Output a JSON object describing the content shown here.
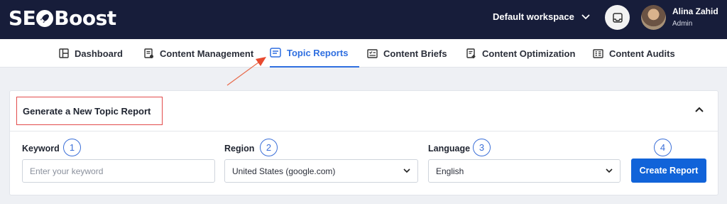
{
  "header": {
    "logo_prefix": "SE",
    "logo_suffix": "Boost",
    "workspace_label": "Default workspace",
    "user_name": "Alina Zahid",
    "user_role": "Admin"
  },
  "nav": {
    "items": [
      {
        "label": "Dashboard",
        "icon": "dashboard-icon"
      },
      {
        "label": "Content Management",
        "icon": "content-management-icon"
      },
      {
        "label": "Topic Reports",
        "icon": "topic-reports-icon",
        "active": true
      },
      {
        "label": "Content Briefs",
        "icon": "content-briefs-icon"
      },
      {
        "label": "Content Optimization",
        "icon": "content-optimization-icon"
      },
      {
        "label": "Content Audits",
        "icon": "content-audits-icon"
      }
    ]
  },
  "card": {
    "title": "Generate a New Topic Report",
    "fields": {
      "keyword": {
        "label": "Keyword",
        "placeholder": "Enter your keyword",
        "step": "1"
      },
      "region": {
        "label": "Region",
        "value": "United States (google.com)",
        "step": "2"
      },
      "language": {
        "label": "Language",
        "value": "English",
        "step": "3"
      }
    },
    "create_button": {
      "label": "Create Report",
      "step": "4"
    }
  },
  "colors": {
    "header_bg": "#171d3a",
    "accent": "#2f6fe0",
    "button": "#1163d9",
    "annotation_red": "#e24b4b",
    "step_blue": "#3b6fd8"
  }
}
